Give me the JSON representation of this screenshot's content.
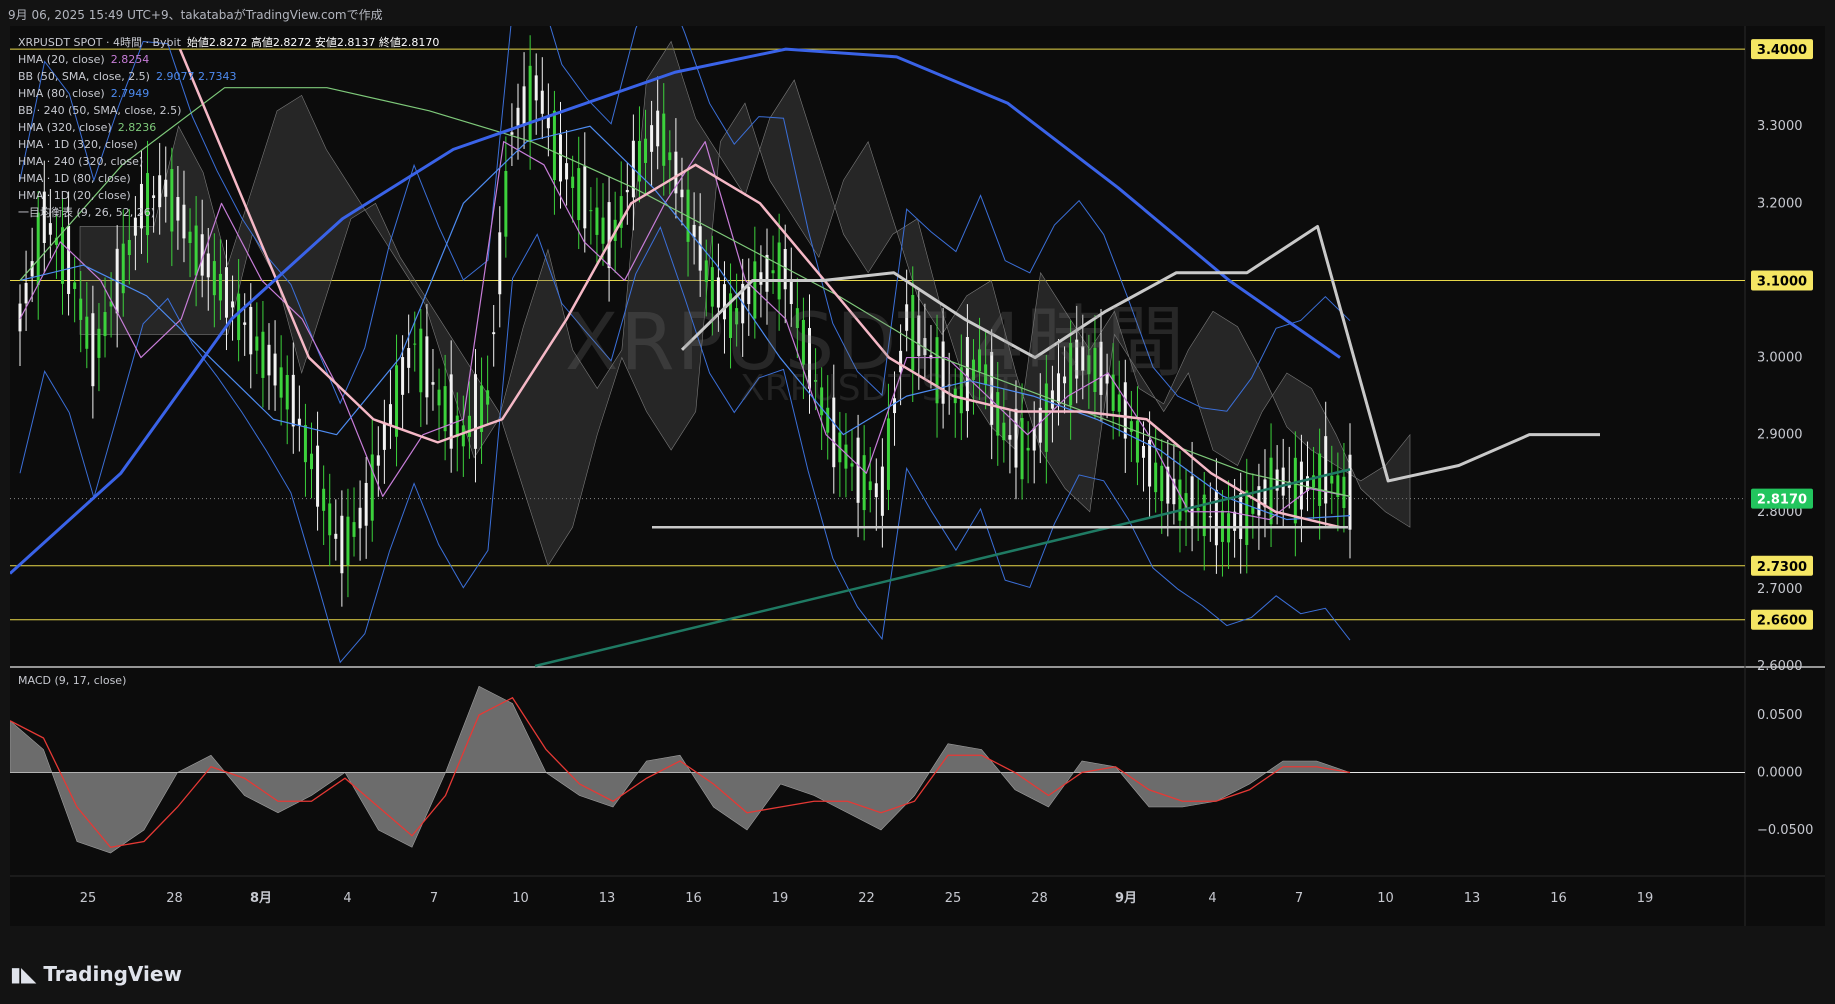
{
  "header": {
    "caption": "9月 06, 2025 15:49 UTC+9、takatabaがTradingView.comで作成"
  },
  "legend": [
    {
      "label": "XRPUSDT SPOT · 4時間 · Bybit",
      "value": "始値2.8272 高値2.8272 安値2.8137 終値2.8170",
      "color": "#ffffff"
    },
    {
      "label": "HMA (20, close)",
      "value": "2.8254",
      "color": "#c77dd8"
    },
    {
      "label": "BB (50, SMA, close, 2.5)",
      "value": "2.9077 2.7343",
      "color": "#4d8bf0"
    },
    {
      "label": "HMA (80, close)",
      "value": "2.7949",
      "color": "#4d8bf0"
    },
    {
      "label": "BB · 240 (50, SMA, close, 2.5)",
      "value": "",
      "color": "#c7c9d0"
    },
    {
      "label": "HMA (320, close)",
      "value": "2.8236",
      "color": "#7ec97a"
    },
    {
      "label": "HMA · 1D (320, close)",
      "value": "",
      "color": "#c7c9d0"
    },
    {
      "label": "HMA · 240 (320, close)",
      "value": "",
      "color": "#c7c9d0"
    },
    {
      "label": "HMA · 1D (80, close)",
      "value": "",
      "color": "#c7c9d0"
    },
    {
      "label": "HMA · 1D (20, close)",
      "value": "",
      "color": "#c7c9d0"
    },
    {
      "label": "一目均衡表 (9, 26, 52, 26)",
      "value": "",
      "color": "#c7c9d0"
    }
  ],
  "watermark": {
    "symbol": "XRPUSDT 4時間",
    "sub": "XRPUSDT SPOT"
  },
  "price_axis": {
    "ticks": [
      "3.3000",
      "3.2000",
      "3.1000",
      "3.0000",
      "2.9000",
      "2.8000",
      "2.7000",
      "2.6000"
    ],
    "tags": [
      {
        "label": "3.4000",
        "color": "#f5e663"
      },
      {
        "label": "3.1000",
        "color": "#f5e663"
      },
      {
        "label": "2.8170",
        "color": "#22c55e"
      },
      {
        "label": "2.7300",
        "color": "#f5e663"
      },
      {
        "label": "2.6600",
        "color": "#f5e663"
      }
    ]
  },
  "macd_panel": {
    "label": "MACD (9, 17, close)",
    "ticks": [
      "0.0500",
      "0.0000",
      "−0.0500"
    ]
  },
  "time_axis": [
    "25",
    "28",
    "8月",
    "4",
    "7",
    "10",
    "13",
    "16",
    "19",
    "22",
    "25",
    "28",
    "9月",
    "4",
    "7",
    "10",
    "13",
    "16",
    "19"
  ],
  "footer": {
    "brand": "TradingView"
  },
  "chart_data": {
    "type": "line",
    "ylim": [
      2.6,
      3.43
    ],
    "horizontal_levels": [
      3.4,
      3.1,
      2.73,
      2.66
    ],
    "last_price": 2.817,
    "price_close_path": [
      3.05,
      3.18,
      3.12,
      3.0,
      3.1,
      3.2,
      3.22,
      3.15,
      3.1,
      3.05,
      3.0,
      2.95,
      2.85,
      2.75,
      2.8,
      2.92,
      3.02,
      2.95,
      2.9,
      2.95,
      3.3,
      3.35,
      3.25,
      3.2,
      3.15,
      3.25,
      3.3,
      3.2,
      3.1,
      3.05,
      3.1,
      3.12,
      3.0,
      2.9,
      2.85,
      2.82,
      3.05,
      3.0,
      2.95,
      3.0,
      2.9,
      2.88,
      2.95,
      3.0,
      2.98,
      2.92,
      2.85,
      2.82,
      2.8,
      2.78,
      2.8,
      2.84,
      2.83,
      2.85,
      2.82
    ],
    "series": [
      {
        "name": "HMA (20, close)",
        "color": "#c77dd8",
        "values": [
          3.05,
          3.15,
          3.1,
          3.0,
          3.05,
          3.2,
          3.1,
          3.05,
          2.95,
          2.82,
          2.9,
          2.92,
          3.28,
          3.25,
          3.15,
          3.1,
          3.2,
          3.28,
          3.1,
          3.05,
          2.9,
          2.85,
          3.0,
          3.0,
          2.95,
          2.9,
          2.95,
          2.98,
          2.9,
          2.8,
          2.8,
          2.79,
          2.83,
          2.82
        ]
      },
      {
        "name": "HMA (80, close)",
        "color": "#4d8bf0",
        "values": [
          3.1,
          3.12,
          3.08,
          3.0,
          2.92,
          2.9,
          3.0,
          3.2,
          3.28,
          3.3,
          3.22,
          3.12,
          3.0,
          2.9,
          2.95,
          2.97,
          2.95,
          2.92,
          2.88,
          2.82,
          2.79,
          2.795
        ]
      },
      {
        "name": "HMA (320, close)",
        "color": "#7ec97a",
        "values": [
          3.1,
          3.25,
          3.35,
          3.35,
          3.32,
          3.28,
          3.22,
          3.15,
          3.08,
          3.0,
          2.95,
          2.9,
          2.85,
          2.82
        ]
      },
      {
        "name": "HMA · 1D (20, close)",
        "color": "#f5b8c6",
        "values": [
          3.4,
          3.2,
          3.0,
          2.92,
          2.89,
          2.92,
          3.05,
          3.2,
          3.25,
          3.2,
          3.1,
          3.0,
          2.95,
          2.93,
          2.93,
          2.92,
          2.85,
          2.8,
          2.78
        ]
      },
      {
        "name": "HMA · 1D (80, close)",
        "color": "#3a63e8",
        "values": [
          2.72,
          2.85,
          3.05,
          3.18,
          3.27,
          3.32,
          3.37,
          3.4,
          3.39,
          3.33,
          3.22,
          3.1,
          3.0
        ]
      },
      {
        "name": "HMA · 240 (320, close)",
        "color": "#c9c9c9",
        "values": [
          3.01,
          3.1,
          3.1,
          3.11,
          3.05,
          3.0,
          3.06,
          3.11,
          3.11,
          3.17,
          2.84,
          2.86,
          2.9,
          2.9
        ]
      }
    ],
    "macd": {
      "ylim": [
        -0.09,
        0.09
      ],
      "histogram": [
        0.045,
        0.02,
        -0.06,
        -0.07,
        -0.05,
        0.0,
        0.015,
        -0.02,
        -0.035,
        -0.02,
        0.0,
        -0.05,
        -0.065,
        0.0,
        0.075,
        0.06,
        0.0,
        -0.02,
        -0.03,
        0.01,
        0.015,
        -0.03,
        -0.05,
        -0.01,
        -0.02,
        -0.035,
        -0.05,
        -0.02,
        0.025,
        0.02,
        -0.015,
        -0.03,
        0.01,
        0.005,
        -0.03,
        -0.03,
        -0.025,
        -0.01,
        0.01,
        0.01,
        0.0
      ],
      "signal": [
        0.045,
        0.03,
        -0.03,
        -0.065,
        -0.06,
        -0.03,
        0.005,
        -0.005,
        -0.025,
        -0.025,
        -0.005,
        -0.03,
        -0.055,
        -0.02,
        0.05,
        0.065,
        0.02,
        -0.01,
        -0.025,
        -0.005,
        0.01,
        -0.01,
        -0.035,
        -0.03,
        -0.025,
        -0.025,
        -0.035,
        -0.025,
        0.015,
        0.015,
        0.0,
        -0.02,
        0.0,
        0.005,
        -0.015,
        -0.025,
        -0.025,
        -0.015,
        0.005,
        0.005,
        0.0
      ]
    }
  }
}
